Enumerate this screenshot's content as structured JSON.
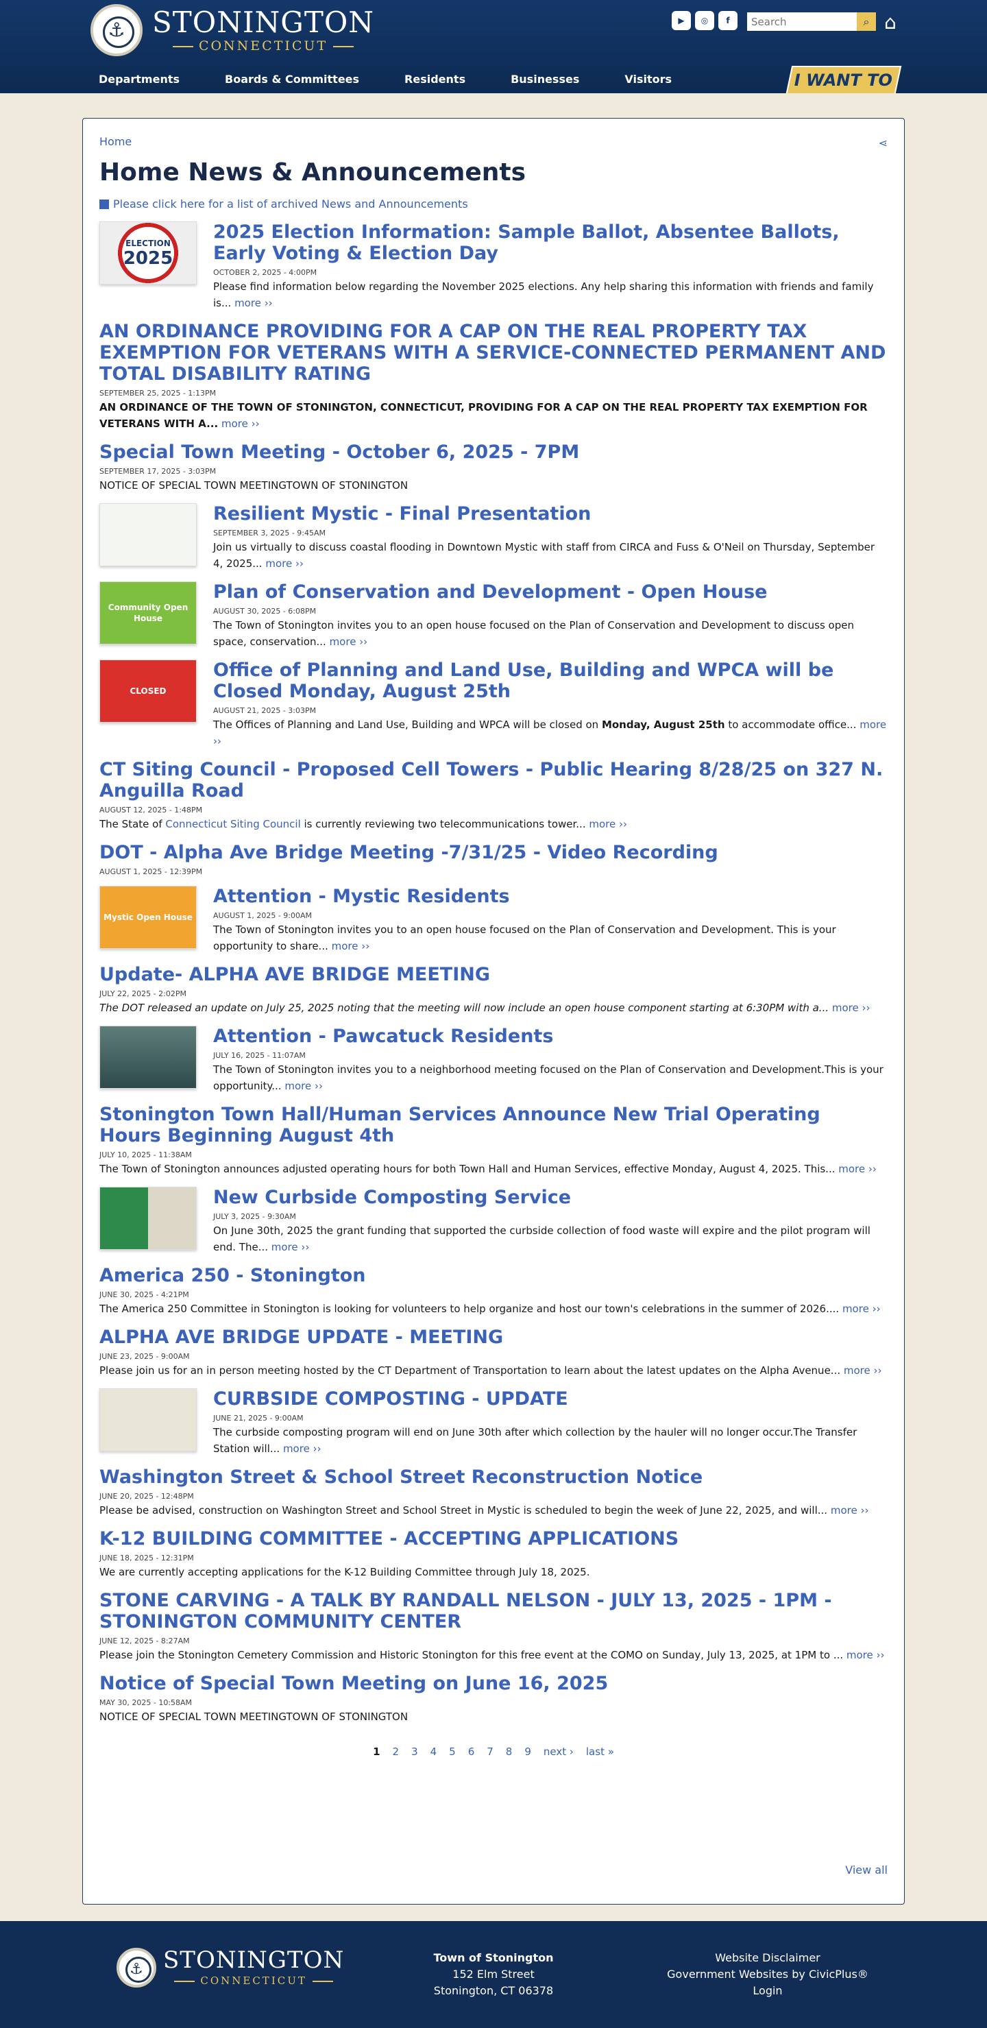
{
  "header": {
    "logo_main": "STONINGTON",
    "logo_sub": "CONNECTICUT",
    "search_placeholder": "Search",
    "nav": [
      "Departments",
      "Boards & Committees",
      "Residents",
      "Businesses",
      "Visitors"
    ],
    "i_want_to": "I WANT TO",
    "social_icons": [
      "youtube-icon",
      "instagram-icon",
      "facebook-icon"
    ]
  },
  "main": {
    "breadcrumb": "Home",
    "title": "Home News & Announcements",
    "archive_link": "Please click here for a list of archived News and Announcements",
    "items": [
      {
        "title": "2025 Election Information: Sample Ballot, Absentee Ballots, Early Voting & Election Day",
        "date": "October 2, 2025 - 4:00PM",
        "desc": "Please find information below regarding the November 2025 elections. Any help sharing this information with friends and family is...",
        "more": "more ››",
        "thumb": "election",
        "thumb_text": "ELECTION",
        "thumb_year": "2025"
      },
      {
        "title": "AN ORDINANCE PROVIDING FOR A CAP ON THE REAL PROPERTY TAX EXEMPTION FOR VETERANS WITH A SERVICE-CONNECTED PERMANENT AND TOTAL DISABILITY RATING",
        "date": "September 25, 2025 - 1:13PM",
        "desc": "AN ORDINANCE OF THE TOWN OF STONINGTON, CONNECTICUT, PROVIDING FOR A CAP ON THE REAL PROPERTY TAX EXEMPTION FOR VETERANS WITH A...",
        "more": "more ››",
        "style": "bold"
      },
      {
        "title": "Special Town Meeting - October 6, 2025 - 7PM",
        "date": "September 17, 2025 - 3:03PM",
        "desc": "NOTICE OF SPECIAL TOWN MEETINGTOWN OF STONINGTON",
        "more": ""
      },
      {
        "title": "Resilient Mystic - Final Presentation",
        "date": "September 3, 2025 - 9:45AM",
        "desc": "Join us virtually to discuss coastal flooding in Downtown Mystic with staff from CIRCA and Fuss & O'Neil on Thursday, September 4, 2025...",
        "more": "more ››",
        "thumb": "resilient"
      },
      {
        "title": "Plan of Conservation and Development - Open House",
        "date": "August 30, 2025 - 6:08PM",
        "desc": "The Town of Stonington invites you to an open house focused on the Plan of Conservation and Development to discuss open space, conservation...",
        "more": "more ››",
        "thumb": "green",
        "thumb_text": "Community Open House"
      },
      {
        "title": "Office of Planning and Land Use, Building and WPCA will be Closed Monday, August 25th",
        "date": "August 21, 2025 - 3:03PM",
        "desc_pre": "The Offices of Planning and Land Use, Building and WPCA will be closed on ",
        "desc_bold": "Monday, August 25th",
        "desc": " to accommodate office...",
        "more": "more ››",
        "thumb": "closed",
        "thumb_text": "CLOSED"
      },
      {
        "title": "CT Siting Council - Proposed Cell Towers - Public Hearing 8/28/25 on 327 N. Anguilla Road",
        "date": "August 12, 2025 - 1:48PM",
        "desc_pre": "The State of ",
        "desc_link": "Connecticut Siting Council",
        "desc": " is currently reviewing two telecommunications tower...",
        "more": "more ››"
      },
      {
        "title": "DOT - Alpha Ave Bridge Meeting -7/31/25 - Video Recording",
        "date": "August 1, 2025 - 12:39PM",
        "desc": "",
        "more": ""
      },
      {
        "title": "Attention - Mystic Residents",
        "date": "August 1, 2025 - 9:00AM",
        "desc": "The Town of Stonington invites you to an open house focused on the Plan of Conservation and Development.  This is your opportunity to share...",
        "more": "more ››",
        "thumb": "orange",
        "thumb_text": "Mystic Open House"
      },
      {
        "title": "Update- ALPHA AVE BRIDGE MEETING",
        "date": "July 22, 2025 - 2:02PM",
        "desc": "The DOT released an update on July 25, 2025 noting that the meeting will now include an open house component starting at 6:30PM with a...",
        "more": "more ››",
        "style": "ital"
      },
      {
        "title": "Attention - Pawcatuck Residents",
        "date": "July 16, 2025 - 11:07AM",
        "desc": "The Town of Stonington invites you to a neighborhood meeting focused on the Plan of Conservation and Development.This is your opportunity...",
        "more": "more ››",
        "thumb": "pawcatuck"
      },
      {
        "title": "Stonington Town Hall/Human Services Announce New Trial Operating Hours Beginning August 4th",
        "date": "July 10, 2025 - 11:38AM",
        "desc": "The Town of Stonington announces adjusted operating hours for both Town Hall and Human Services, effective Monday, August 4, 2025. This...",
        "more": "more ››"
      },
      {
        "title": "New Curbside Composting Service",
        "date": "July 3, 2025 - 9:30AM",
        "desc": "On June 30th, 2025 the grant funding that supported the curbside collection of food waste will expire and the pilot program will end. The...",
        "more": "more ››",
        "thumb": "compost"
      },
      {
        "title": "America 250 - Stonington",
        "date": "June 30, 2025 - 4:21PM",
        "desc": "The America 250 Committee in Stonington is looking for volunteers to help organize and host our town's celebrations in the summer of 2026....",
        "more": "more ››"
      },
      {
        "title": "ALPHA AVE BRIDGE UPDATE - MEETING",
        "date": "June 23, 2025 - 9:00AM",
        "desc": "Please join us for an in person meeting hosted by the CT Department of Transportation to learn about the latest updates on the Alpha Avenue...",
        "more": "more ››"
      },
      {
        "title": "CURBSIDE COMPOSTING - UPDATE",
        "date": "June 21, 2025 - 9:00AM",
        "desc": "The curbside composting program will end on June 30th after which collection by the hauler will no longer occur.The Transfer Station will...",
        "more": "more ››",
        "thumb": "compost2"
      },
      {
        "title": "Washington Street & School Street Reconstruction Notice",
        "date": "June 20, 2025 - 12:48PM",
        "desc": "Please be advised, construction on Washington Street and School Street in Mystic is scheduled to begin the week of June 22, 2025, and will...",
        "more": "more ››"
      },
      {
        "title": "K-12 BUILDING COMMITTEE - ACCEPTING APPLICATIONS",
        "date": "June 18, 2025 - 12:31PM",
        "desc": "We are currently accepting applications for the K-12 Building Committee through July 18, 2025.",
        "more": ""
      },
      {
        "title": "STONE CARVING - A TALK BY RANDALL NELSON - JULY 13, 2025 - 1PM - STONINGTON COMMUNITY CENTER",
        "date": "June 12, 2025 - 8:27AM",
        "desc": "Please join the Stonington Cemetery Commission and Historic Stonington for this free event at the COMO on Sunday, July 13, 2025, at 1PM to ...",
        "more": "more ››"
      },
      {
        "title": "Notice of Special Town Meeting on June 16, 2025",
        "date": "May 30, 2025 - 10:58AM",
        "desc": "NOTICE OF SPECIAL TOWN MEETINGTOWN OF STONINGTON",
        "more": ""
      }
    ],
    "pager": [
      "1",
      "2",
      "3",
      "4",
      "5",
      "6",
      "7",
      "8",
      "9",
      "next ›",
      "last »"
    ],
    "view_all": "View all"
  },
  "footer": {
    "logo_main": "STONINGTON",
    "logo_sub": "CONNECTICUT",
    "addr_name": "Town of Stonington",
    "addr_line1": "152 Elm Street",
    "addr_line2": "Stonington, CT 06378",
    "links": [
      "Website Disclaimer",
      "Government Websites by CivicPlus®",
      "Login"
    ]
  }
}
